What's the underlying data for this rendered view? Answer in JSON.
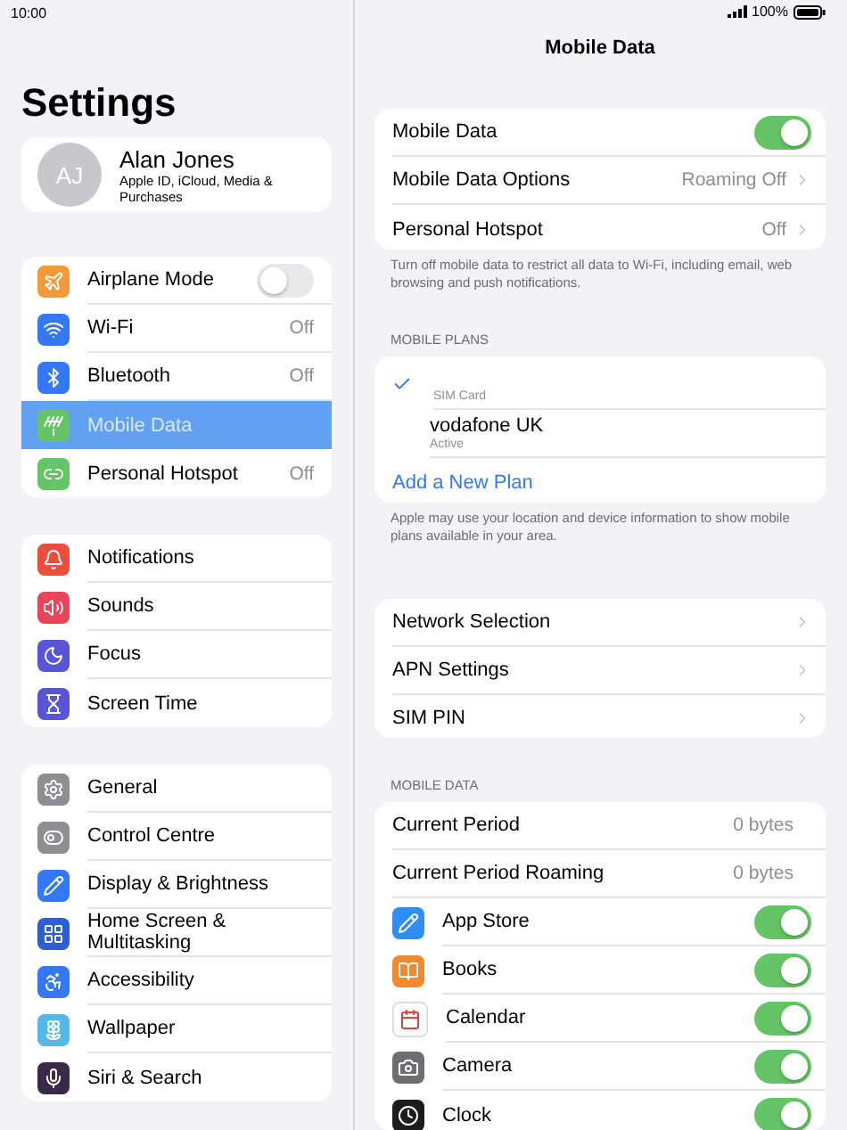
{
  "status_bar": {
    "time": "10:00",
    "battery": "100%"
  },
  "sidebar": {
    "title": "Settings",
    "profile": {
      "initials": "AJ",
      "name": "Alan Jones",
      "subtitle": "Apple ID, iCloud, Media & Purchases"
    },
    "groups": [
      {
        "items": [
          {
            "label": "Airplane Mode",
            "kind": "toggle",
            "on": false,
            "selected": false
          },
          {
            "label": "Wi-Fi",
            "kind": "value",
            "value": "Off",
            "selected": false
          },
          {
            "label": "Bluetooth",
            "kind": "value",
            "value": "Off",
            "selected": false
          },
          {
            "label": "Mobile Data",
            "kind": "plain",
            "selected": true
          },
          {
            "label": "Personal Hotspot",
            "kind": "value",
            "value": "Off",
            "selected": false
          }
        ]
      },
      {
        "items": [
          {
            "label": "Notifications",
            "kind": "plain",
            "selected": false
          },
          {
            "label": "Sounds",
            "kind": "plain",
            "selected": false
          },
          {
            "label": "Focus",
            "kind": "plain",
            "selected": false
          },
          {
            "label": "Screen Time",
            "kind": "plain",
            "selected": false
          }
        ]
      },
      {
        "items": [
          {
            "label": "General",
            "kind": "plain",
            "selected": false
          },
          {
            "label": "Control Centre",
            "kind": "plain",
            "selected": false
          },
          {
            "label": "Display & Brightness",
            "kind": "plain",
            "selected": false
          },
          {
            "label": "Home Screen & Multitasking",
            "kind": "plain",
            "selected": false
          },
          {
            "label": "Accessibility",
            "kind": "plain",
            "selected": false
          },
          {
            "label": "Wallpaper",
            "kind": "plain",
            "selected": false
          },
          {
            "label": "Siri & Search",
            "kind": "plain",
            "selected": false
          }
        ]
      }
    ]
  },
  "detail": {
    "title": "Mobile Data",
    "sections": [
      {
        "rows": [
          {
            "kind": "toggle",
            "label": "Mobile Data",
            "on": true
          },
          {
            "kind": "link",
            "label": "Mobile Data Options",
            "value": "Roaming Off"
          },
          {
            "kind": "link",
            "label": "Personal Hotspot",
            "value": "Off"
          }
        ],
        "footer": "Turn off mobile data to restrict all data to Wi-Fi, including email, web browsing and push notifications."
      },
      {
        "header": "MOBILE PLANS",
        "rows": [
          {
            "kind": "plan",
            "caption": "SIM Card",
            "selected": true
          },
          {
            "kind": "carrier",
            "label": "vodafone UK",
            "status": "Active"
          },
          {
            "kind": "action",
            "label": "Add a New Plan"
          }
        ],
        "footer": "Apple may use your location and device information to show mobile plans available in your area."
      },
      {
        "rows": [
          {
            "kind": "link",
            "label": "Network Selection"
          },
          {
            "kind": "link",
            "label": "APN Settings"
          },
          {
            "kind": "link",
            "label": "SIM PIN"
          }
        ]
      },
      {
        "header": "MOBILE DATA",
        "rows": [
          {
            "kind": "stat",
            "label": "Current Period",
            "value": "0 bytes"
          },
          {
            "kind": "stat",
            "label": "Current Period Roaming",
            "value": "0 bytes"
          },
          {
            "kind": "app",
            "label": "App Store",
            "on": true
          },
          {
            "kind": "app",
            "label": "Books",
            "on": true
          },
          {
            "kind": "app",
            "label": "Calendar",
            "on": true
          },
          {
            "kind": "app",
            "label": "Camera",
            "on": true
          },
          {
            "kind": "app",
            "label": "Clock",
            "on": true
          }
        ]
      }
    ]
  }
}
